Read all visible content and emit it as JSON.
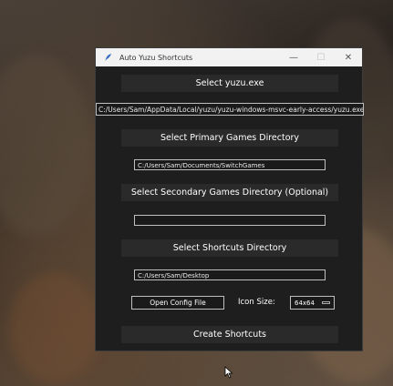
{
  "window": {
    "title": "Auto Yuzu Shortcuts",
    "controls": {
      "minimize": "—",
      "maximize": "☐",
      "close": "✕"
    }
  },
  "buttons": {
    "select_yuzu": "Select yuzu.exe",
    "select_primary": "Select Primary Games Directory",
    "select_secondary": "Select Secondary Games Directory (Optional)",
    "select_shortcuts": "Select Shortcuts Directory",
    "open_config": "Open Config File",
    "create_shortcuts": "Create Shortcuts"
  },
  "fields": {
    "yuzu_path": "C:/Users/Sam/AppData/Local/yuzu/yuzu-windows-msvc-early-access/yuzu.exe",
    "primary_dir": "C:/Users/Sam/Documents/SwitchGames",
    "secondary_dir": "",
    "shortcuts_dir": "C:/Users/Sam/Desktop"
  },
  "icon_size": {
    "label": "Icon Size:",
    "selected": "64x64"
  },
  "colors": {
    "window_bg": "#1e1e1e",
    "button_bg": "#2a2a2a",
    "titlebar_bg": "#f2f2f2"
  }
}
